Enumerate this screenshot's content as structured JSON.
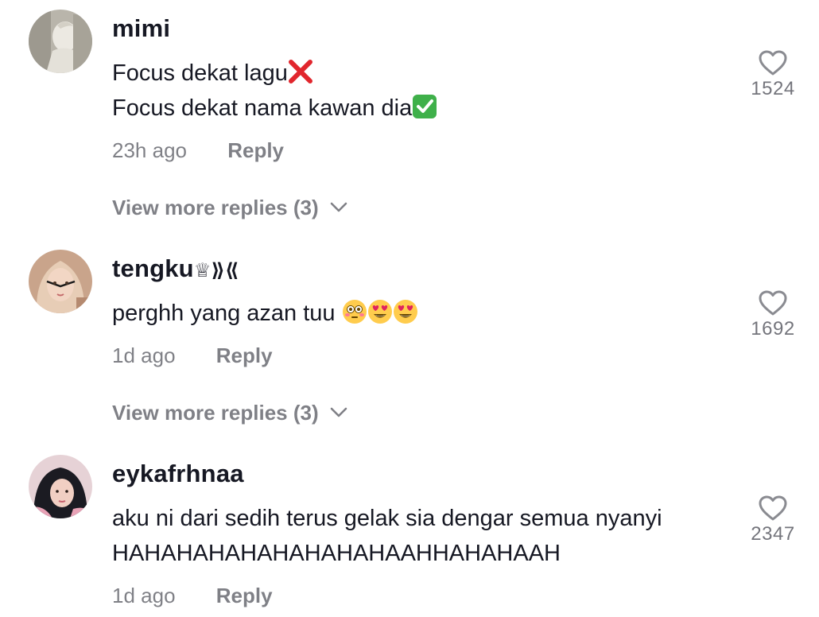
{
  "comments": [
    {
      "username": "mimi",
      "lines": [
        "Focus dekat lagu",
        "Focus dekat nama kawan dia"
      ],
      "line_emojis": [
        "cross-mark-emoji",
        "check-mark-button-emoji"
      ],
      "time": "23h ago",
      "reply_label": "Reply",
      "view_more": "View more replies (3)",
      "likes": "1524"
    },
    {
      "username": "tengku",
      "username_suffix": "♕⟫⟪",
      "lines": [
        "perghh yang azan tuu "
      ],
      "line_emojis": [
        "flushed-face-emoji smiling-face-with-heart-eyes-emoji smiling-face-with-heart-eyes-emoji"
      ],
      "time": "1d ago",
      "reply_label": "Reply",
      "view_more": "View more replies (3)",
      "likes": "1692"
    },
    {
      "username": "eykafrhnaa",
      "lines": [
        "aku ni dari sedih terus gelak sia dengar semua nyanyi",
        "HAHAHAHAHAHAHAHAHAAHHAHAHAAH"
      ],
      "time": "1d ago",
      "reply_label": "Reply",
      "likes": "2347"
    }
  ],
  "colors": {
    "text": "#161823",
    "muted": "rgba(22,24,35,0.55)",
    "heart_stroke": "#8a8b91",
    "cross_red": "#e1262d",
    "check_green": "#3fb04a"
  },
  "icons": [
    "heart-outline-icon",
    "chevron-down-icon"
  ]
}
